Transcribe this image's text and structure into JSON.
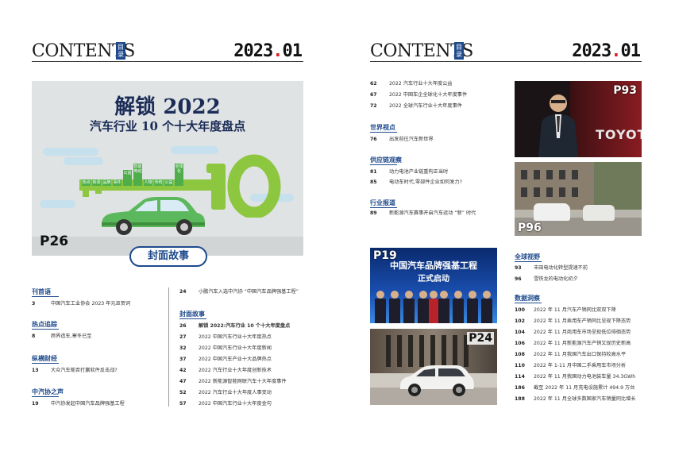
{
  "header": {
    "word": "CONTENTS",
    "box_text": "目录",
    "year_a": "2023",
    "year_dot": ".",
    "year_b": "01"
  },
  "cover": {
    "title": "解锁 2022",
    "subtitle": "汽车行业 10 个十大年度盘点",
    "big_number": "10",
    "key_tags": [
      "热点",
      "新闻",
      "品牌",
      "事件",
      "公益",
      "智能电动",
      "人物",
      "传统",
      "公益",
      "全球化"
    ],
    "page_badge": "P26",
    "button_label": "封面故事"
  },
  "left_toc": {
    "col1": [
      {
        "type": "section",
        "title": "刊首语"
      },
      {
        "type": "row",
        "page": "3",
        "text": "中国汽车工业协会 2023 年元旦贺词"
      },
      {
        "type": "section",
        "title": "热点追踪"
      },
      {
        "type": "row",
        "page": "8",
        "text": "跨界造车,寒冬已至"
      },
      {
        "type": "section",
        "title": "纵横财经"
      },
      {
        "type": "row",
        "page": "13",
        "text": "大众汽车能否打赢软件反击战?"
      },
      {
        "type": "section",
        "title": "中汽协之声"
      },
      {
        "type": "row",
        "page": "19",
        "text": "中汽协发起中国汽车品牌强基工程"
      }
    ],
    "col2": [
      {
        "type": "row",
        "page": "24",
        "text": "小鹏汽车入选中汽协 “中国汽车品牌强基工程”"
      },
      {
        "type": "section",
        "title": "封面故事"
      },
      {
        "type": "row",
        "page": "26",
        "text": "解锁 2022:汽车行业 10 个十大年度盘点",
        "bold": true
      },
      {
        "type": "row",
        "page": "27",
        "text": "2022 中国汽车行业十大年度热点"
      },
      {
        "type": "row",
        "page": "32",
        "text": "2022 中国汽车行业十大年度新闻"
      },
      {
        "type": "row",
        "page": "37",
        "text": "2022 中国汽车产业十大品牌热点"
      },
      {
        "type": "row",
        "page": "42",
        "text": "2022 汽车行业十大年度创新技术"
      },
      {
        "type": "row",
        "page": "47",
        "text": "2022 新能源智能网联汽车十大年度事件"
      },
      {
        "type": "row",
        "page": "52",
        "text": "2022 汽车行业十大年度人事变动"
      },
      {
        "type": "row",
        "page": "57",
        "text": "2022 中国汽车行业十大年度金句"
      }
    ]
  },
  "right_toc": {
    "top": [
      {
        "type": "row",
        "page": "62",
        "text": "2022 汽车行业十大年度公益"
      },
      {
        "type": "row",
        "page": "67",
        "text": "2022 中国车企全球化十大年度事件"
      },
      {
        "type": "row",
        "page": "72",
        "text": "2022 全球汽车行业十大年度事件"
      },
      {
        "type": "section",
        "title": "世界视点"
      },
      {
        "type": "row",
        "page": "76",
        "text": "出发前往汽车新世界"
      },
      {
        "type": "section",
        "title": "供应链观察"
      },
      {
        "type": "row",
        "page": "81",
        "text": "动力电池产业链重构正当时"
      },
      {
        "type": "row",
        "page": "85",
        "text": "电动车时代,零部件企业如何发力?"
      },
      {
        "type": "section",
        "title": "行业报道"
      },
      {
        "type": "row",
        "page": "89",
        "text": "新能源汽车赛事开启汽车运动 “新” 时代"
      }
    ],
    "bottom": [
      {
        "type": "section",
        "title": "全球视野"
      },
      {
        "type": "row",
        "page": "93",
        "text": "丰田电动化转型提速不前"
      },
      {
        "type": "row",
        "page": "96",
        "text": "雪铁龙的电动化初夕"
      },
      {
        "type": "section",
        "title": "数据洞察"
      },
      {
        "type": "row",
        "page": "100",
        "text": "2022 年 11 月汽车产销同比双双下降"
      },
      {
        "type": "row",
        "page": "102",
        "text": "2022 年 11 月乘用车产销同比呈现下降态势"
      },
      {
        "type": "row",
        "page": "104",
        "text": "2022 年 11 月商用车市场呈现低位徘徊态势"
      },
      {
        "type": "row",
        "page": "106",
        "text": "2022 年 11 月新能源汽车产销又现历史新高"
      },
      {
        "type": "row",
        "page": "108",
        "text": "2022 年 11 月我国汽车出口保持较高水平"
      },
      {
        "type": "row",
        "page": "110",
        "text": "2022 年 1-11 月中国二手乘用车市场分析"
      },
      {
        "type": "row",
        "page": "114",
        "text": "2022 年 11 月我国动力电池装车量 34.3GWh"
      },
      {
        "type": "row",
        "page": "186",
        "text": "截至 2022 年 11 月充电设施累计 494.9 万台"
      },
      {
        "type": "row",
        "page": "188",
        "text": "2022 年 11 月全球多数国家汽车销量同比增长"
      }
    ]
  },
  "photos": {
    "p93": {
      "label": "P93",
      "sign_text": "TOYOTA"
    },
    "p96": {
      "label": "P96"
    },
    "p19": {
      "label": "P19",
      "title_line1": "中国汽车品牌强基工程",
      "title_line2": "正式启动"
    },
    "p24": {
      "label": "P24"
    }
  },
  "colors": {
    "accent": "#1e4a8c",
    "red": "#e02020",
    "green": "#8dc63f"
  }
}
